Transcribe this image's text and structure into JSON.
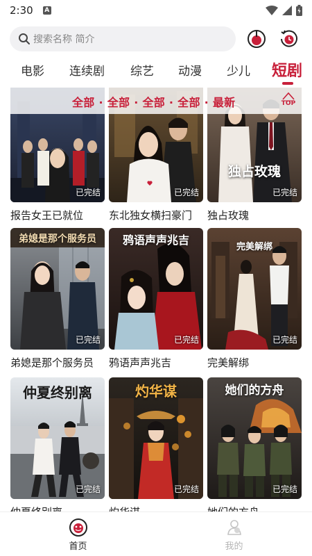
{
  "status_bar": {
    "time": "2:30",
    "notification_glyph": "A"
  },
  "search": {
    "placeholder": "搜索名称 简介"
  },
  "tabs": [
    {
      "label": "电影",
      "active": false
    },
    {
      "label": "连续剧",
      "active": false
    },
    {
      "label": "综艺",
      "active": false
    },
    {
      "label": "动漫",
      "active": false
    },
    {
      "label": "少儿",
      "active": false
    },
    {
      "label": "短剧",
      "active": true
    }
  ],
  "filter": {
    "text": "全部 · 全部 · 全部 · 全部 · 最新",
    "top_label": "TOP"
  },
  "badge_text": "已完结",
  "items": [
    {
      "title": "报告女王已就位",
      "poster_text": ""
    },
    {
      "title": "东北独女横扫豪门",
      "poster_text": ""
    },
    {
      "title": "独占玫瑰",
      "poster_text": "独占玫瑰"
    },
    {
      "title": "弟媳是那个服务员",
      "poster_text": "弟媳是那个服务员"
    },
    {
      "title": "鸦语声声兆吉",
      "poster_text": "鸦语声声兆吉"
    },
    {
      "title": "完美解绑",
      "poster_text": "完美解绑"
    },
    {
      "title": "仲夏终别离",
      "poster_text": "仲夏终别离"
    },
    {
      "title": "灼华谋",
      "poster_text": "灼华谋"
    },
    {
      "title": "她们的方舟",
      "poster_text": "她们的方舟"
    }
  ],
  "bottom_nav": [
    {
      "label": "首页",
      "icon": "home-icon",
      "active": true
    },
    {
      "label": "我的",
      "icon": "profile-icon",
      "active": false
    }
  ],
  "colors": {
    "accent": "#c8203a",
    "search_bg": "#f1f1f3"
  }
}
